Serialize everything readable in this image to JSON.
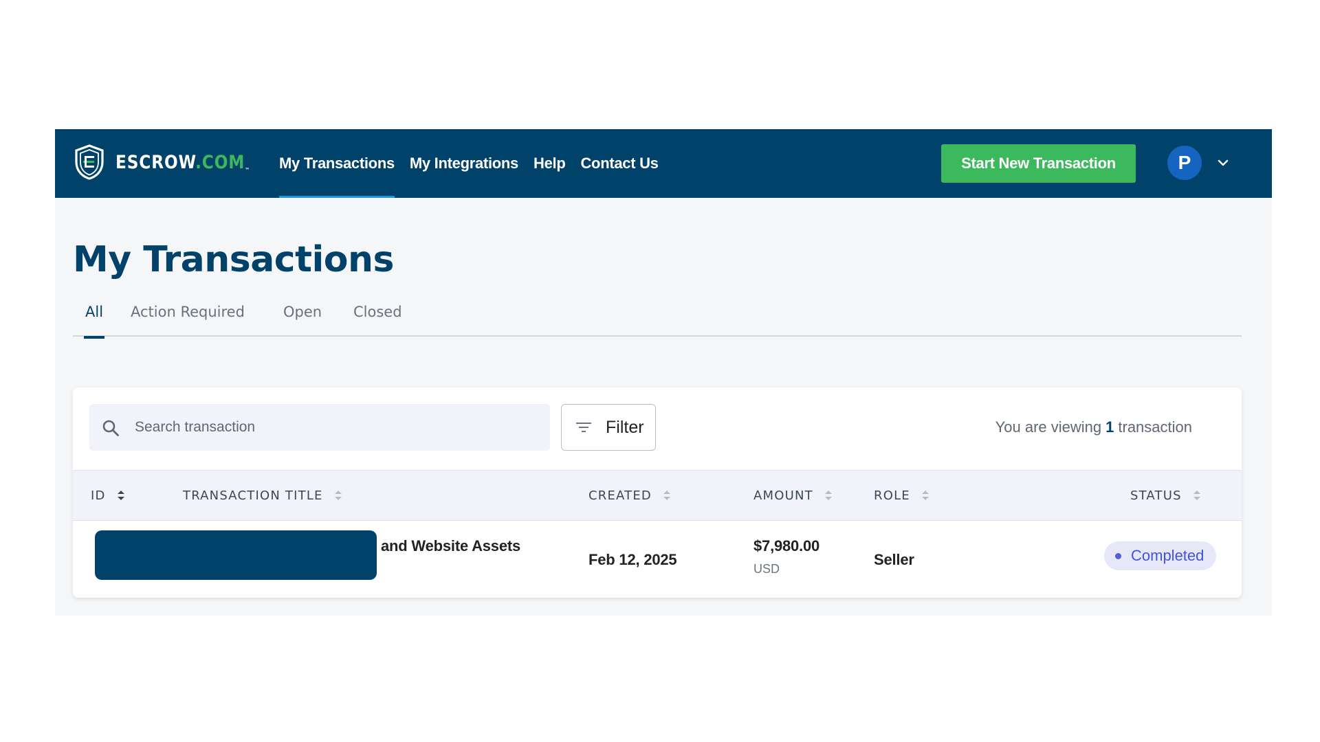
{
  "app": {
    "logo_text": "ESCROW",
    "logo_suffix": ".COM",
    "logo_tm": "™"
  },
  "nav": {
    "items": [
      {
        "label": "My Transactions",
        "active": true
      },
      {
        "label": "My Integrations",
        "active": false
      },
      {
        "label": "Help",
        "active": false
      },
      {
        "label": "Contact Us",
        "active": false
      }
    ],
    "start_button_label": "Start New Transaction",
    "avatar_initial": "P"
  },
  "page": {
    "title": "My Transactions",
    "tabs": [
      {
        "label": "All",
        "active": true
      },
      {
        "label": "Action Required",
        "active": false
      },
      {
        "label": "Open",
        "active": false
      },
      {
        "label": "Closed",
        "active": false
      }
    ]
  },
  "toolbar": {
    "search_placeholder": "Search transaction",
    "filter_label": "Filter",
    "viewing_prefix": "You are viewing",
    "viewing_count": "1",
    "viewing_suffix": "transaction"
  },
  "table": {
    "columns": [
      "ID",
      "TRANSACTION TITLE",
      "CREATED",
      "AMOUNT",
      "ROLE",
      "STATUS"
    ],
    "rows": [
      {
        "title_visible": "and Website Assets",
        "created": "Feb 12, 2025",
        "amount": "$7,980.00",
        "currency": "USD",
        "role": "Seller",
        "status": "Completed"
      }
    ]
  },
  "colors": {
    "brand_navy": "#01426a",
    "brand_green": "#3cb95d",
    "nav_active_underline": "#1a9bd8",
    "status_completed": "#4453d6",
    "status_badge_bg": "#e6e8f7"
  }
}
